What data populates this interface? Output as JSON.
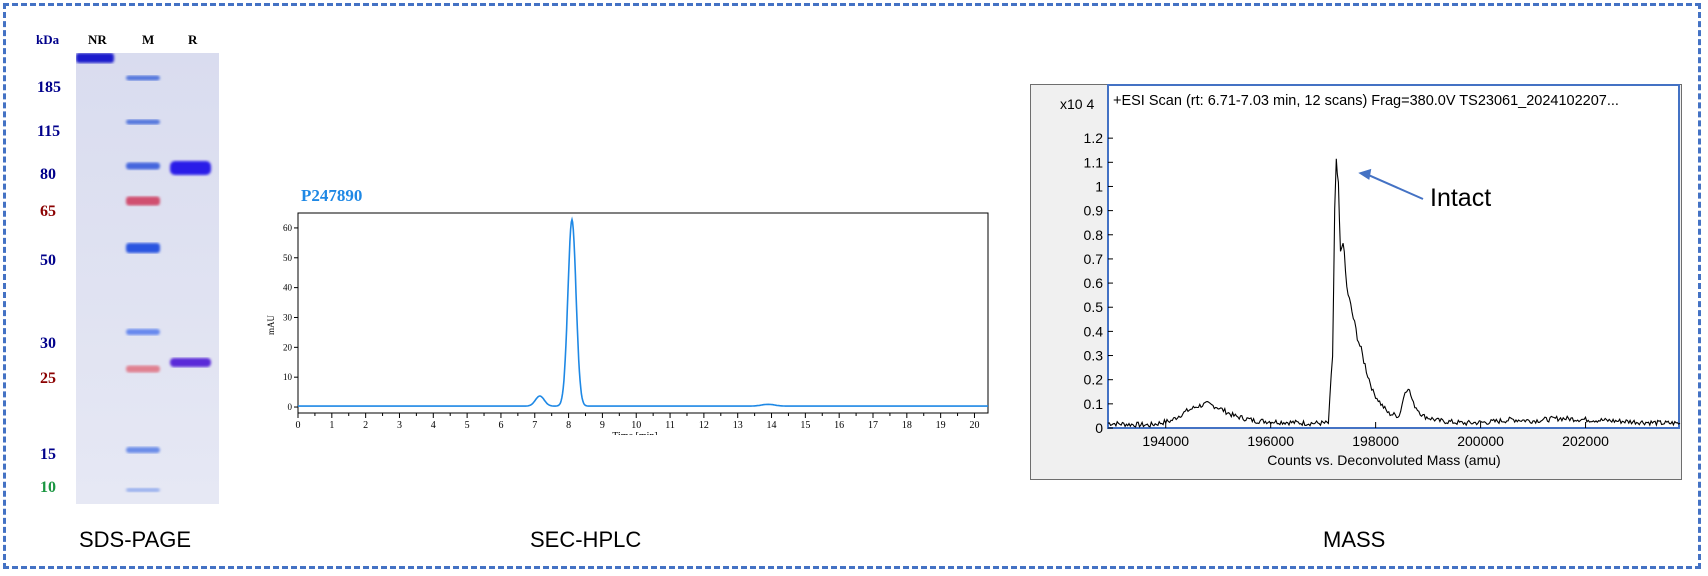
{
  "frame": {
    "border_color": "#4472c4"
  },
  "sds_page": {
    "title": "SDS-PAGE",
    "lane_headers": {
      "kda": "kDa",
      "nr": "NR",
      "m": "M",
      "r": "R"
    },
    "markers": [
      {
        "label": "185",
        "kda": 185,
        "color": "#00008b"
      },
      {
        "label": "115",
        "kda": 115,
        "color": "#00008b"
      },
      {
        "label": "80",
        "kda": 80,
        "color": "#00008b"
      },
      {
        "label": "65",
        "kda": 65,
        "color": "#8b0000"
      },
      {
        "label": "50",
        "kda": 50,
        "color": "#00008b"
      },
      {
        "label": "30",
        "kda": 30,
        "color": "#00008b"
      },
      {
        "label": "25",
        "kda": 25,
        "color": "#8b0000"
      },
      {
        "label": "15",
        "kda": 15,
        "color": "#00008b"
      },
      {
        "label": "10",
        "kda": 10,
        "color": "#1a9641"
      }
    ]
  },
  "sec_hplc": {
    "title": "SEC-HPLC",
    "sample_id": "P247890",
    "line_color": "#1e88e5",
    "chart_data": {
      "type": "line",
      "title": "P247890",
      "xlabel": "Time [min]",
      "ylabel": "mAU",
      "xlim": [
        0,
        20.4
      ],
      "ylim": [
        -2,
        65
      ],
      "xticks": [
        "0",
        "1",
        "2",
        "3",
        "4",
        "5",
        "6",
        "7",
        "8",
        "9",
        "10",
        "11",
        "12",
        "13",
        "14",
        "15",
        "16",
        "17",
        "18",
        "19",
        "20"
      ],
      "yticks": [
        "0",
        "10",
        "20",
        "30",
        "40",
        "50",
        "60"
      ],
      "peaks": [
        {
          "x": 7.15,
          "y": 3.4,
          "width": 0.13
        },
        {
          "x": 8.1,
          "y": 62.5,
          "width": 0.12
        },
        {
          "x": 13.9,
          "y": 0.6,
          "width": 0.2
        }
      ],
      "baseline": 0.3
    }
  },
  "mass": {
    "title": "MASS",
    "header": "+ESI Scan (rt: 6.71-7.03 min, 12 scans) Frag=380.0V TS23061_2024102207...",
    "scale_label": "x10 4",
    "annotation": "Intact",
    "chart_data": {
      "type": "line",
      "xlabel": "Counts vs. Deconvoluted Mass (amu)",
      "ylabel": "",
      "xlim": [
        192900,
        203800
      ],
      "ylim": [
        0,
        1.3
      ],
      "xticks": [
        "194000",
        "196000",
        "198000",
        "200000",
        "202000"
      ],
      "yticks": [
        "0",
        "0.1",
        "0.2",
        "0.3",
        "0.4",
        "0.5",
        "0.6",
        "0.7",
        "0.8",
        "0.9",
        "1",
        "1.1",
        "1.2"
      ],
      "points": [
        [
          192900,
          0.02
        ],
        [
          193300,
          0.015
        ],
        [
          193700,
          0.012
        ],
        [
          194100,
          0.03
        ],
        [
          194400,
          0.07
        ],
        [
          194600,
          0.09
        ],
        [
          194800,
          0.1
        ],
        [
          195000,
          0.085
        ],
        [
          195300,
          0.05
        ],
        [
          195700,
          0.03
        ],
        [
          196200,
          0.025
        ],
        [
          196700,
          0.02
        ],
        [
          197100,
          0.02
        ],
        [
          197180,
          0.3
        ],
        [
          197220,
          0.9
        ],
        [
          197250,
          1.1
        ],
        [
          197290,
          1.0
        ],
        [
          197330,
          0.72
        ],
        [
          197380,
          0.78
        ],
        [
          197450,
          0.58
        ],
        [
          197550,
          0.48
        ],
        [
          197650,
          0.38
        ],
        [
          197750,
          0.3
        ],
        [
          197850,
          0.22
        ],
        [
          197950,
          0.15
        ],
        [
          198100,
          0.1
        ],
        [
          198250,
          0.06
        ],
        [
          198450,
          0.05
        ],
        [
          198560,
          0.15
        ],
        [
          198620,
          0.17
        ],
        [
          198720,
          0.1
        ],
        [
          198900,
          0.05
        ],
        [
          199200,
          0.03
        ],
        [
          199700,
          0.02
        ],
        [
          200200,
          0.025
        ],
        [
          200600,
          0.035
        ],
        [
          201000,
          0.03
        ],
        [
          201500,
          0.04
        ],
        [
          202000,
          0.035
        ],
        [
          202500,
          0.03
        ],
        [
          203000,
          0.025
        ],
        [
          203500,
          0.02
        ],
        [
          203800,
          0.02
        ]
      ]
    }
  }
}
